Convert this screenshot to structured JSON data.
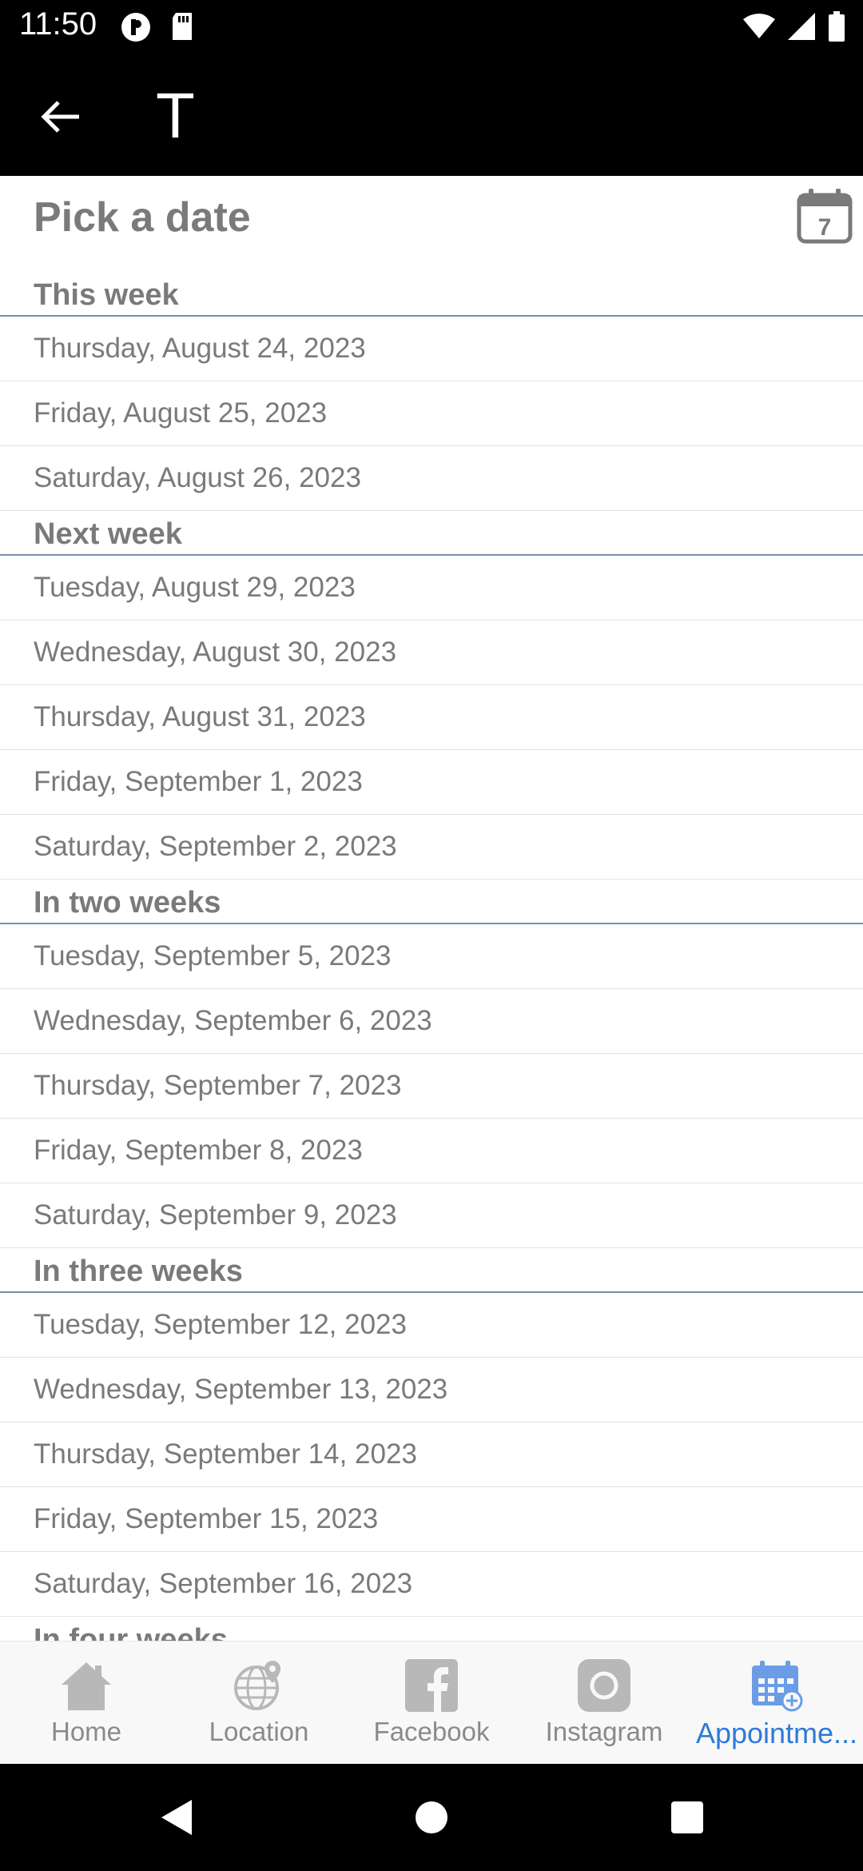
{
  "status": {
    "time": "11:50"
  },
  "app_bar": {
    "title": "T"
  },
  "page": {
    "title": "Pick a date"
  },
  "sections": [
    {
      "header": "This week",
      "dates": [
        "Thursday, August 24, 2023",
        "Friday, August 25, 2023",
        "Saturday, August 26, 2023"
      ]
    },
    {
      "header": "Next week",
      "dates": [
        "Tuesday, August 29, 2023",
        "Wednesday, August 30, 2023",
        "Thursday, August 31, 2023",
        "Friday, September 1, 2023",
        "Saturday, September 2, 2023"
      ]
    },
    {
      "header": "In two weeks",
      "dates": [
        "Tuesday, September 5, 2023",
        "Wednesday, September 6, 2023",
        "Thursday, September 7, 2023",
        "Friday, September 8, 2023",
        "Saturday, September 9, 2023"
      ]
    },
    {
      "header": "In three weeks",
      "dates": [
        "Tuesday, September 12, 2023",
        "Wednesday, September 13, 2023",
        "Thursday, September 14, 2023",
        "Friday, September 15, 2023",
        "Saturday, September 16, 2023"
      ]
    },
    {
      "header": "In four weeks",
      "dates": []
    }
  ],
  "bottom_nav": {
    "items": [
      {
        "label": "Home",
        "icon": "home-icon"
      },
      {
        "label": "Location",
        "icon": "globe-location-icon"
      },
      {
        "label": "Facebook",
        "icon": "facebook-icon"
      },
      {
        "label": "Instagram",
        "icon": "instagram-icon"
      },
      {
        "label": "Appointme...",
        "icon": "calendar-add-icon",
        "active": true
      }
    ]
  },
  "colors": {
    "active": "#2d7bd8",
    "inactive": "#8a8a8a",
    "divider": "#7b8fad"
  }
}
